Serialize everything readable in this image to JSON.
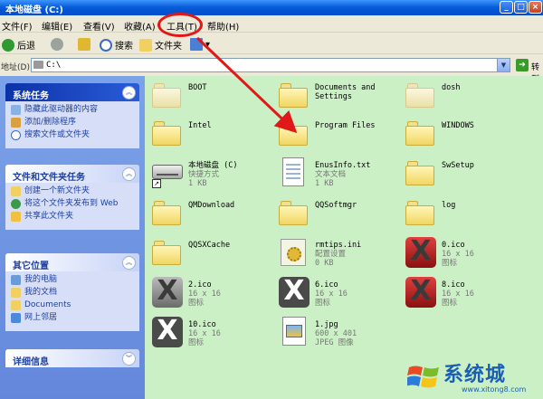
{
  "window": {
    "title": "本地磁盘 (C:)",
    "btn_min": "_",
    "btn_max": "□",
    "btn_close": "×"
  },
  "menubar": {
    "items": [
      "文件(F)",
      "编辑(E)",
      "查看(V)",
      "收藏(A)",
      "工具(T)",
      "帮助(H)"
    ],
    "highlighted": "工具(T)",
    "highlight_color": "#e01818"
  },
  "toolbar": {
    "back_label": "后退",
    "search_label": "搜索",
    "folders_label": "文件夹"
  },
  "addressbar": {
    "label": "地址(D)",
    "value": "C:\\",
    "go_label": "转到"
  },
  "taskpane": {
    "system_tasks": {
      "title": "系统任务",
      "items": [
        "隐藏此驱动器的内容",
        "添加/删除程序",
        "搜索文件或文件夹"
      ]
    },
    "file_tasks": {
      "title": "文件和文件夹任务",
      "items": [
        "创建一个新文件夹",
        "将这个文件夹发布到 Web",
        "共享此文件夹"
      ]
    },
    "other_places": {
      "title": "其它位置",
      "items": [
        "我的电脑",
        "我的文档",
        "Documents",
        "网上邻居"
      ]
    },
    "details": {
      "title": "详细信息"
    }
  },
  "files": [
    {
      "name": "BOOT",
      "line2": "",
      "line3": "",
      "kind": "folder-faded"
    },
    {
      "name": "Documents and",
      "line2": "Settings",
      "line3": "",
      "kind": "folder"
    },
    {
      "name": "dosh",
      "line2": "",
      "line3": "",
      "kind": "folder-faded"
    },
    {
      "name": "Intel",
      "line2": "",
      "line3": "",
      "kind": "folder"
    },
    {
      "name": "Program Files",
      "line2": "",
      "line3": "",
      "kind": "folder"
    },
    {
      "name": "WINDOWS",
      "line2": "",
      "line3": "",
      "kind": "folder"
    },
    {
      "name": "本地磁盘 (C)",
      "line2": "快捷方式",
      "line3": "1 KB",
      "kind": "drive"
    },
    {
      "name": "EnusInfo.txt",
      "line2": "文本文档",
      "line3": "1 KB",
      "kind": "txt"
    },
    {
      "name": "SwSetup",
      "line2": "",
      "line3": "",
      "kind": "folder"
    },
    {
      "name": "QMDownload",
      "line2": "",
      "line3": "",
      "kind": "folder"
    },
    {
      "name": "QQSoftmgr",
      "line2": "",
      "line3": "",
      "kind": "folder"
    },
    {
      "name": "log",
      "line2": "",
      "line3": "",
      "kind": "folder"
    },
    {
      "name": "QQSXCache",
      "line2": "",
      "line3": "",
      "kind": "folder"
    },
    {
      "name": "rmtips.ini",
      "line2": "配置设置",
      "line3": "0 KB",
      "kind": "ini"
    },
    {
      "name": "0.ico",
      "line2": "16 x 16",
      "line3": "图标",
      "kind": "ico-red"
    },
    {
      "name": "2.ico",
      "line2": "16 x 16",
      "line3": "图标",
      "kind": "ico-gray"
    },
    {
      "name": "6.ico",
      "line2": "16 x 16",
      "line3": "图标",
      "kind": "ico-dark"
    },
    {
      "name": "8.ico",
      "line2": "16 x 16",
      "line3": "图标",
      "kind": "ico-red"
    },
    {
      "name": "10.ico",
      "line2": "16 x 16",
      "line3": "图标",
      "kind": "ico-dark"
    },
    {
      "name": "1.jpg",
      "line2": "600 x 401",
      "line3": "JPEG 图像",
      "kind": "jpg"
    }
  ],
  "watermark": {
    "text": "系统城",
    "url": "www.xitong8.com"
  }
}
